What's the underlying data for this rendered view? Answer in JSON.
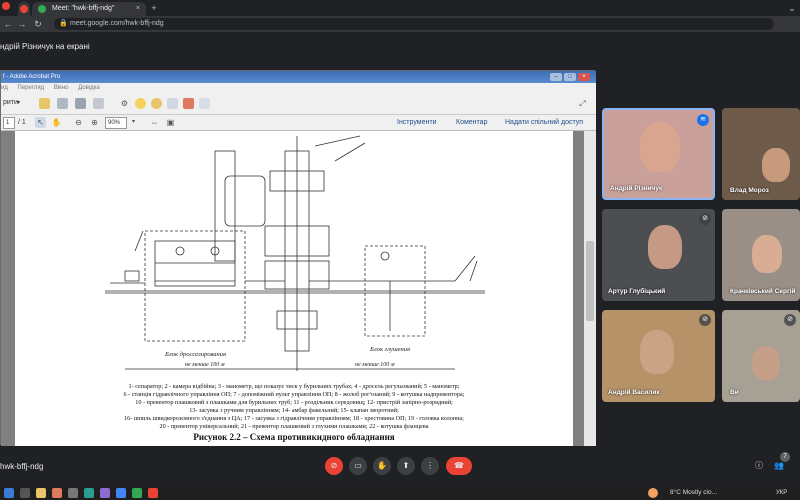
{
  "browser": {
    "tabs": [
      {
        "label": "Meet: \"hwk-bffj-ndg\"",
        "active": true
      },
      {
        "label": "",
        "active": false
      }
    ],
    "url": "meet.google.com/hwk-bffj-ndg",
    "new_tab_glyph": "+",
    "tab_close_glyph": "×",
    "window_glyph": "⌄"
  },
  "meet": {
    "share_banner": "ндрій Різничук на екрані",
    "meeting_code": "hwk-bffj-ndg",
    "participant_count": "7",
    "participants": [
      {
        "name": "Андрій Різничук",
        "speaking": true
      },
      {
        "name": "Влад Мороз",
        "speaking": false
      },
      {
        "name": "Артур Глубіцький",
        "speaking": false
      },
      {
        "name": "Крачківський Сергій",
        "speaking": false
      },
      {
        "name": "Андрій Василик",
        "speaking": false
      },
      {
        "name": "Ви",
        "speaking": false
      }
    ],
    "controls": [
      "mic-off-icon",
      "camera-icon",
      "hand-icon",
      "present-icon",
      "more-icon",
      "end-call-icon"
    ]
  },
  "acrobat": {
    "title": "f - Adobe Acrobat Pro",
    "menu": [
      "ид",
      "Перегляд",
      "Вікно",
      "Довідка"
    ],
    "create_label": "рити",
    "page_current": "1",
    "page_total": "/ 1",
    "zoom": "90%",
    "links": [
      "Інструменти",
      "Коментар",
      "Надати спільний доступ"
    ]
  },
  "document": {
    "legend_lines": [
      "1- сепаратор; 2 - камера відбійна; 3 - манометр, що показує тиск у бурильних трубах; 4 - дросель регульований; 5 - манометр;",
      "6 - станція гідравлічного управління ОП; 7 - допоміжний пульт управління ОП; 8 - жолоб рог'озаний; 9 - котушка надпревентора;",
      "10 - превентор плашковий з плашками для бурильних труб; 11 - роздільник середовищ; 12- пристрій запірно-розрядний;",
      "13- засувка з ручним управлінням; 14- амбар факельний; 15- клапан зворотний;",
      "16- шпиль швидкорозємного з'єднання з ЦА; 17 - засувка з гідравлічним управлінням; 18 - хрестовина ОП; 19 - головка колонна;",
      "20 - превентор універсальний; 21 - превентор плашковий з глухими плашками; 22 - котушка фланцева"
    ],
    "caption": "Рисунок 2.2 – Схема противикидного обладнання",
    "label_block_left": "Блок дросселирования",
    "label_block_right": "Блок глушения",
    "label_dim_left": "не менше 100 м",
    "label_dim_right": "не менше 100 м"
  },
  "taskbar": {
    "weather": "8°C  Mostly clo...",
    "language": "УКР"
  }
}
